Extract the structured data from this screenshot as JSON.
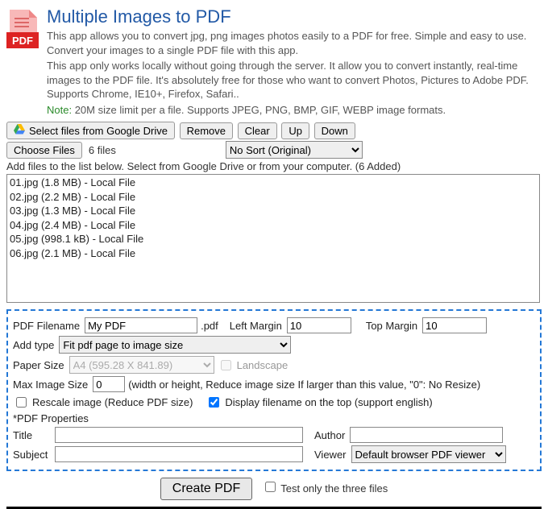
{
  "header": {
    "title": "Multiple Images to PDF",
    "desc1": "This app allows you to convert jpg, png images photos easily to a PDF for free. Simple and easy to use. Convert your images to a single PDF file with this app.",
    "desc2": "This app only works locally without going through the server. It allow you to convert instantly, real-time images to the PDF file. It's absolutely free for those who want to convert Photos, Pictures to Adobe PDF. Supports Chrome, IE10+, Firefox, Safari..",
    "note_label": "Note:",
    "note_text": " 20M size limit per a file. Supports JPEG, PNG, BMP, GIF, WEBP image formats."
  },
  "toolbar": {
    "gdrive": "Select files from Google Drive",
    "remove": "Remove",
    "clear": "Clear",
    "up": "Up",
    "down": "Down",
    "choose_files": "Choose Files",
    "file_count": "6 files",
    "sort_selected": "No Sort (Original)"
  },
  "list": {
    "label": "Add files to the list below. Select from Google Drive or from your computer. (6 Added)",
    "files": [
      "01.jpg (1.8 MB) - Local File",
      "02.jpg (2.2 MB) - Local File",
      "03.jpg (1.3 MB) - Local File",
      "04.jpg (2.4 MB) - Local File",
      "05.jpg (998.1 kB) - Local File",
      "06.jpg (2.1 MB) - Local File"
    ]
  },
  "options": {
    "pdf_filename_label": "PDF Filename",
    "pdf_filename_value": "My PDF",
    "ext": ".pdf",
    "left_margin_label": "Left Margin",
    "left_margin_value": "10",
    "top_margin_label": "Top Margin",
    "top_margin_value": "10",
    "add_type_label": "Add type",
    "add_type_value": "Fit pdf page to image size",
    "paper_size_label": "Paper Size",
    "paper_size_value": "A4 (595.28 X 841.89)",
    "landscape_label": "Landscape",
    "max_image_size_label": "Max Image Size",
    "max_image_size_value": "0",
    "max_image_size_hint": "(width or height, Reduce image size If larger than this value, \"0\": No Resize)",
    "rescale_label": "Rescale image (Reduce PDF size)",
    "display_filename_label": "Display filename on the top (support english)",
    "props_title": "*PDF Properties",
    "title_label": "Title",
    "title_value": "",
    "author_label": "Author",
    "author_value": "",
    "subject_label": "Subject",
    "subject_value": "",
    "viewer_label": "Viewer",
    "viewer_value": "Default browser PDF viewer"
  },
  "footer": {
    "create_pdf": "Create PDF",
    "test_only": "Test only the three files"
  }
}
